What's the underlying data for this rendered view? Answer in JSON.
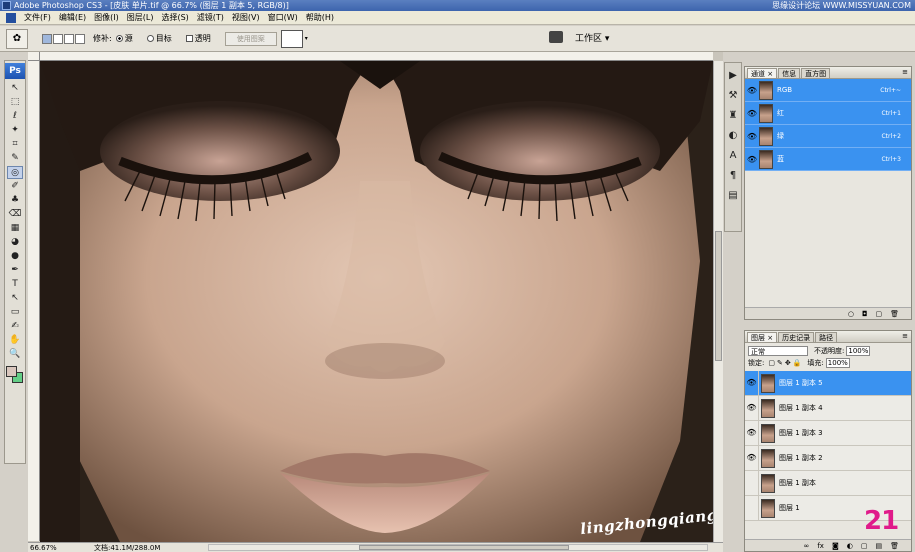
{
  "window": {
    "title": "Adobe Photoshop CS3 - [皮肤 单片.tif @ 66.7% (图层 1 副本 5, RGB/8)]",
    "site_watermark": "思缘设计论坛 WWW.MISSYUAN.COM"
  },
  "menu": [
    "文件(F)",
    "编辑(E)",
    "图像(I)",
    "图层(L)",
    "选择(S)",
    "滤镜(T)",
    "视图(V)",
    "窗口(W)",
    "帮助(H)"
  ],
  "options": {
    "patch_label": "修补:",
    "source": "源",
    "target": "目标",
    "transparent": "透明",
    "use_pattern": "使用图案",
    "pattern_arrow": "▾",
    "workspace": "工作区 ▾"
  },
  "toolbox": {
    "logo": "Ps",
    "tools": [
      "↖",
      "⬚",
      "ℓ",
      "✦",
      "⌗",
      "✎",
      "◎",
      "✐",
      "♣",
      "⌫",
      "▦",
      "◕",
      "●",
      "✒",
      "T",
      "↖",
      "▭",
      "✍",
      "✋",
      "🔍"
    ]
  },
  "document": {
    "zoom": "66.67%",
    "doc_size": "文档:41.1M/288.0M",
    "signature": "lingzhongqiang"
  },
  "right_strip": {
    "icons": [
      "▶",
      "⚒",
      "♜",
      "◐",
      "A",
      "¶",
      "▤"
    ]
  },
  "channels_panel": {
    "tabs": [
      "通道 ×",
      "信息",
      "直方图"
    ],
    "menu": "≡",
    "channels": [
      {
        "name": "RGB",
        "shortcut": "Ctrl+~"
      },
      {
        "name": "红",
        "shortcut": "Ctrl+1"
      },
      {
        "name": "绿",
        "shortcut": "Ctrl+2"
      },
      {
        "name": "蓝",
        "shortcut": "Ctrl+3"
      }
    ],
    "footer_icons": [
      "○",
      "◘",
      "▢",
      "🗑"
    ]
  },
  "layers_panel": {
    "tabs": [
      "图层 ×",
      "历史记录",
      "路径"
    ],
    "menu": "≡",
    "blend_mode": "正常",
    "opacity_label": "不透明度:",
    "opacity_value": "100%",
    "lock_label": "锁定:",
    "lock_icons": "▢✎✥🔒",
    "fill_label": "填充:",
    "fill_value": "100%",
    "layers": [
      {
        "name": "图层 1 副本 5",
        "selected": true,
        "visible": true
      },
      {
        "name": "图层 1 副本 4",
        "selected": false,
        "visible": true
      },
      {
        "name": "图层 1 副本 3",
        "selected": false,
        "visible": true
      },
      {
        "name": "图层 1 副本 2",
        "selected": false,
        "visible": true
      },
      {
        "name": "图层 1 副本",
        "selected": false,
        "visible": false
      },
      {
        "name": "图层 1",
        "selected": false,
        "visible": false
      }
    ],
    "footer_icons": [
      "∞",
      "fx",
      "◙",
      "◐",
      "▢",
      "▤",
      "🗑"
    ]
  },
  "badge": "21",
  "colors": {
    "selection_blue": "#3a92f0",
    "foreground": "#d9c6bd",
    "background": "#63ce86",
    "badge": "#e01a8a"
  }
}
